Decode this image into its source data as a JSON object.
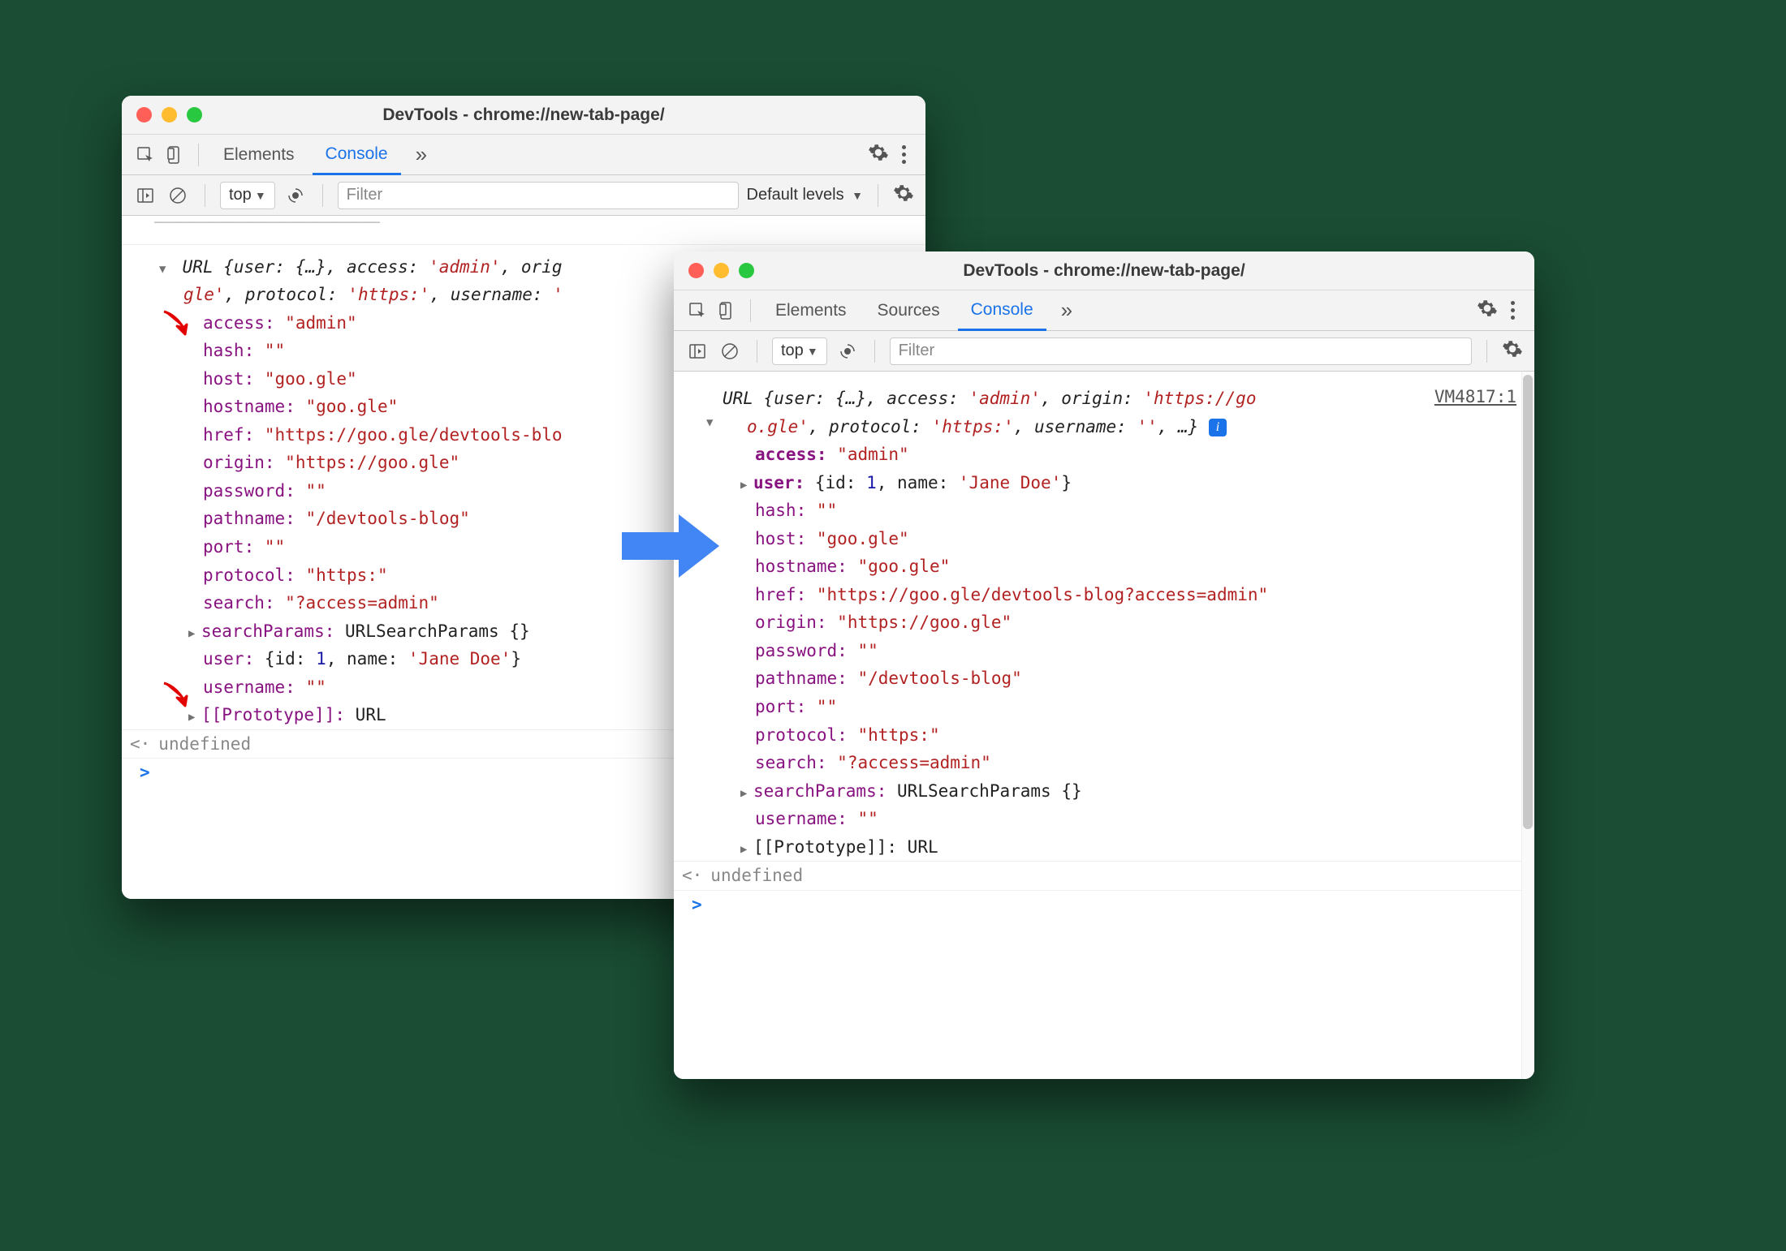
{
  "left": {
    "title": "DevTools - chrome://new-tab-page/",
    "tabs": {
      "elements": "Elements",
      "console": "Console"
    },
    "filter": {
      "context": "top",
      "placeholder": "Filter",
      "levels": "Default levels"
    },
    "summary": {
      "pre": "URL {user: {…}, access: ",
      "access": "'admin'",
      "mid1": ", orig",
      "line2a": "gle'",
      "mid2": ", protocol: ",
      "protocol": "'https:'",
      "mid3": ", username: ",
      "username": "'"
    },
    "props": {
      "access_k": "access:",
      "access_v": "\"admin\"",
      "hash_k": "hash:",
      "hash_v": "\"\"",
      "host_k": "host:",
      "host_v": "\"goo.gle\"",
      "hostname_k": "hostname:",
      "hostname_v": "\"goo.gle\"",
      "href_k": "href:",
      "href_v": "\"https://goo.gle/devtools-blo",
      "origin_k": "origin:",
      "origin_v": "\"https://goo.gle\"",
      "password_k": "password:",
      "password_v": "\"\"",
      "pathname_k": "pathname:",
      "pathname_v": "\"/devtools-blog\"",
      "port_k": "port:",
      "port_v": "\"\"",
      "protocol_k": "protocol:",
      "protocol_v": "\"https:\"",
      "search_k": "search:",
      "search_v": "\"?access=admin\"",
      "searchParams_k": "searchParams:",
      "searchParams_v": "URLSearchParams {}",
      "user_k": "user:",
      "user_v_pre": "{id: ",
      "user_id": "1",
      "user_v_mid": ", name: ",
      "user_name": "'Jane Doe'",
      "user_v_post": "}",
      "username_k": "username:",
      "username_v": "\"\"",
      "proto_k": "[[Prototype]]:",
      "proto_v": "URL"
    },
    "result": "undefined"
  },
  "right": {
    "title": "DevTools - chrome://new-tab-page/",
    "tabs": {
      "elements": "Elements",
      "sources": "Sources",
      "console": "Console"
    },
    "filter": {
      "context": "top",
      "placeholder": "Filter"
    },
    "source_link": "VM4817:1",
    "summary": {
      "pre": "URL {user: {…}, access: ",
      "access": "'admin'",
      "mid1": ", origin: ",
      "origin": "'https://go",
      "line2a": "o.gle'",
      "mid2": ", protocol: ",
      "protocol": "'https:'",
      "mid3": ", username: ",
      "username": "''",
      "post": ", …} "
    },
    "props": {
      "access_k": "access:",
      "access_v": "\"admin\"",
      "user_k": "user:",
      "user_v_pre": "{id: ",
      "user_id": "1",
      "user_v_mid": ", name: ",
      "user_name": "'Jane Doe'",
      "user_v_post": "}",
      "hash_k": "hash:",
      "hash_v": "\"\"",
      "host_k": "host:",
      "host_v": "\"goo.gle\"",
      "hostname_k": "hostname:",
      "hostname_v": "\"goo.gle\"",
      "href_k": "href:",
      "href_v": "\"https://goo.gle/devtools-blog?access=admin\"",
      "origin_k": "origin:",
      "origin_v": "\"https://goo.gle\"",
      "password_k": "password:",
      "password_v": "\"\"",
      "pathname_k": "pathname:",
      "pathname_v": "\"/devtools-blog\"",
      "port_k": "port:",
      "port_v": "\"\"",
      "protocol_k": "protocol:",
      "protocol_v": "\"https:\"",
      "search_k": "search:",
      "search_v": "\"?access=admin\"",
      "searchParams_k": "searchParams:",
      "searchParams_v": "URLSearchParams {}",
      "username_k": "username:",
      "username_v": "\"\"",
      "proto_k": "[[Prototype]]:",
      "proto_v": "URL"
    },
    "result": "undefined"
  }
}
